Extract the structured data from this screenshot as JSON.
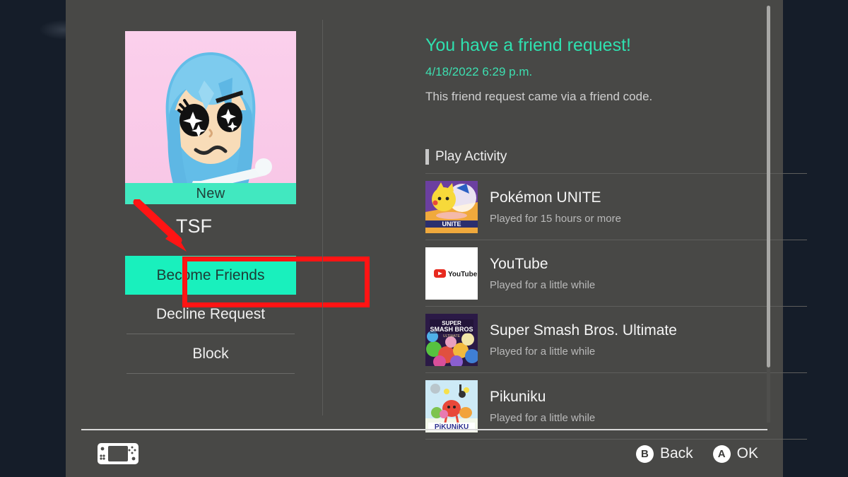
{
  "letterbox": {
    "color": "#151d29"
  },
  "panel": {
    "background": "#484846"
  },
  "profile": {
    "username": "TSF",
    "new_badge": "New",
    "avatar_background": "#f9c9e8",
    "hair_color": "#6cc4ee",
    "banner_color": "#41e8c0"
  },
  "menu": {
    "items": [
      {
        "label": "Become Friends",
        "selected": true
      },
      {
        "label": "Decline Request",
        "selected": false
      },
      {
        "label": "Block",
        "selected": false
      }
    ],
    "selected_color": "#19f0bd"
  },
  "annotation": {
    "color": "#ff1414",
    "highlights": "Become Friends"
  },
  "request": {
    "title": "You have a friend request!",
    "timestamp": "4/18/2022 6:29 p.m.",
    "note": "This friend request came via a friend code.",
    "title_color": "#2fe0af"
  },
  "play_activity": {
    "section_label": "Play Activity",
    "items": [
      {
        "title": "Pokémon UNITE",
        "subtitle": "Played for 15 hours or more",
        "thumb": "pokemon-unite-icon"
      },
      {
        "title": "YouTube",
        "subtitle": "Played for a little while",
        "thumb": "youtube-icon"
      },
      {
        "title": "Super Smash Bros. Ultimate",
        "subtitle": "Played for a little while",
        "thumb": "smash-bros-icon"
      },
      {
        "title": "Pikuniku",
        "subtitle": "Played for a little while",
        "thumb": "pikuniku-icon"
      }
    ]
  },
  "footer": {
    "console_icon": "switch-console-icon",
    "hints": [
      {
        "glyph": "B",
        "label": "Back"
      },
      {
        "glyph": "A",
        "label": "OK"
      }
    ]
  }
}
